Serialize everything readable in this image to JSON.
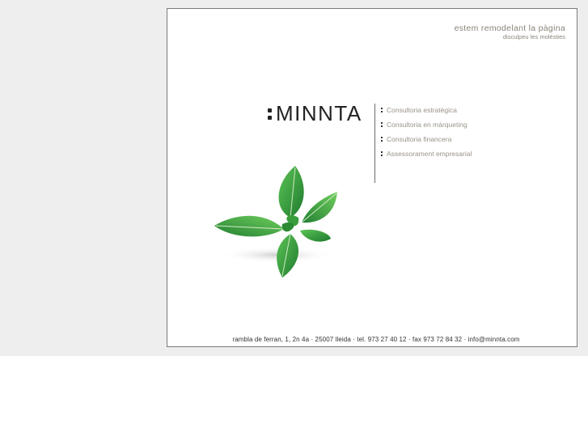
{
  "notice": {
    "main": "estem remodelant la pàgina",
    "sub": "disculpeu les molèsties"
  },
  "logo": {
    "text": "MINNTA"
  },
  "services": [
    "Consultoria estratègica",
    "Consultoria en màrqueting",
    "Consultoria financera",
    "Assessorament empresarial"
  ],
  "footer": {
    "address": "rambla de ferran, 1, 2n 4a · 25007 lleida · tel. 973 27 40 12 · fax 973 72 84 32 · info@minnta.com"
  },
  "colors": {
    "background": "#eeeeee",
    "frame_border": "#7a7a7a",
    "text_muted": "#9a9488",
    "logo": "#222222",
    "leaf_dark": "#1f7a2e",
    "leaf_light": "#4cb84a"
  },
  "icons": [
    "mint-leaf-image",
    "colon-bullet-icon"
  ]
}
